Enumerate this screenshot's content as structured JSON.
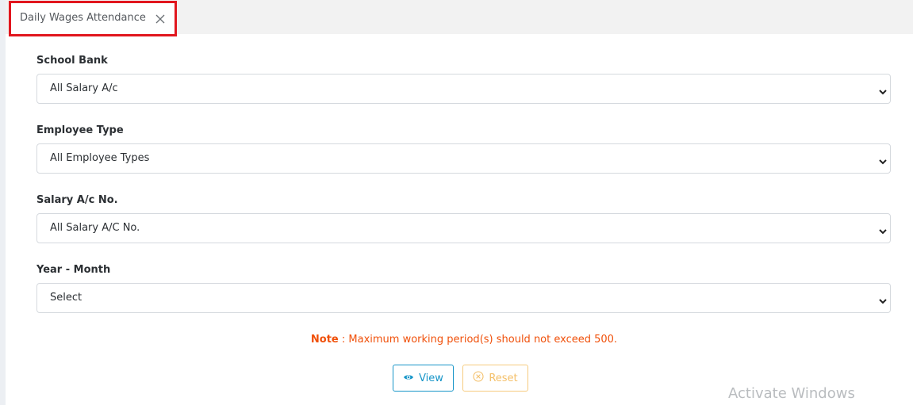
{
  "tab": {
    "title": "Daily Wages Attendance",
    "close_icon": "close-icon"
  },
  "form": {
    "school_bank": {
      "label": "School Bank",
      "value": "All Salary A/c"
    },
    "employee_type": {
      "label": "Employee Type",
      "value": "All Employee Types"
    },
    "salary_ac_no": {
      "label": "Salary A/c No.",
      "value": "All Salary A/C No."
    },
    "year_month": {
      "label": "Year - Month",
      "value": "Select"
    }
  },
  "note": {
    "prefix": "Note",
    "text": " : Maximum working period(s) should not exceed 500."
  },
  "buttons": {
    "view_label": "View",
    "view_icon": "eye-icon",
    "reset_label": "Reset",
    "reset_icon": "close-circle-icon"
  },
  "watermark": {
    "text": "Activate Windows"
  },
  "colors": {
    "tab_highlight_border": "#e1161e",
    "note_text": "#f0500a",
    "view_button": "#1795c8",
    "reset_button": "#f4c06a"
  }
}
